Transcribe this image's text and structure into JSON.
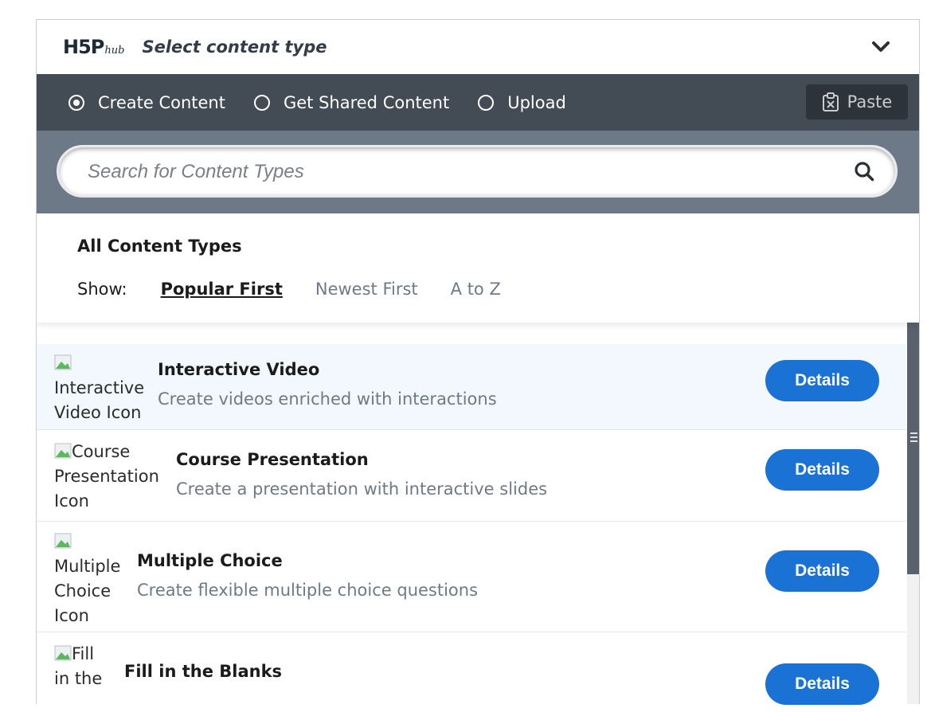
{
  "header": {
    "logo_main": "H5P",
    "logo_sub": "hub",
    "title": "Select content type",
    "toggle_icon": "chevron-down-icon"
  },
  "tabs": [
    {
      "label": "Create Content",
      "selected": true
    },
    {
      "label": "Get Shared Content",
      "selected": false
    },
    {
      "label": "Upload",
      "selected": false
    }
  ],
  "paste": {
    "label": "Paste",
    "icon": "clipboard-icon"
  },
  "search": {
    "placeholder": "Search for Content Types",
    "value": "",
    "icon": "search-icon"
  },
  "types": {
    "title": "All Content Types",
    "show_label": "Show:",
    "sort_options": [
      {
        "label": "Popular First",
        "active": true
      },
      {
        "label": "Newest First",
        "active": false
      },
      {
        "label": "A to Z",
        "active": false
      }
    ]
  },
  "items": [
    {
      "icon_alt": [
        "Interactive",
        "Video Icon"
      ],
      "name": "Interactive Video",
      "desc": "Create videos enriched with interactions",
      "button": "Details",
      "highlighted": true
    },
    {
      "icon_alt": [
        "Course",
        "Presentation",
        "Icon"
      ],
      "name": "Course Presentation",
      "desc": "Create a presentation with interactive slides",
      "button": "Details",
      "highlighted": false
    },
    {
      "icon_alt": [
        "Multiple",
        "Choice",
        "Icon"
      ],
      "name": "Multiple Choice",
      "desc": "Create flexible multiple choice questions",
      "button": "Details",
      "highlighted": false
    },
    {
      "icon_alt": [
        "Fill",
        "in the"
      ],
      "name": "Fill in the Blanks",
      "desc": "",
      "button": "Details",
      "highlighted": false
    }
  ],
  "colors": {
    "tab_bar": "#434b55",
    "search_bar": "#6d7987",
    "button_blue": "#1a73d4",
    "highlight_row": "#f2f8fd"
  }
}
